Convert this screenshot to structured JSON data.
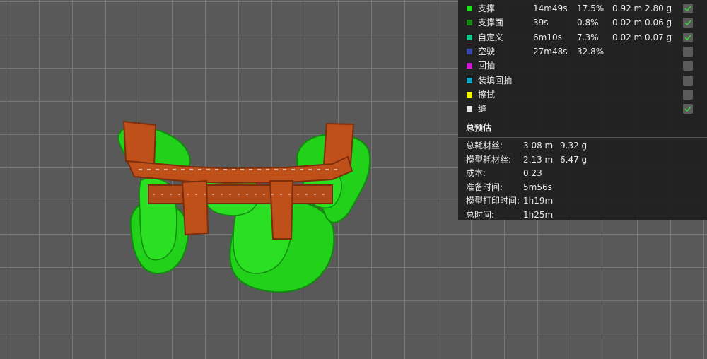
{
  "legend": {
    "rows": [
      {
        "name": "支撑",
        "time": "14m49s",
        "percent": "17.5%",
        "length": "0.92 m",
        "weight": "2.80 g",
        "color": "#21e01d",
        "checked": true
      },
      {
        "name": "支撑面",
        "time": "39s",
        "percent": "0.8%",
        "length": "0.02 m",
        "weight": "0.06 g",
        "color": "#1a8a16",
        "checked": true
      },
      {
        "name": "自定义",
        "time": "6m10s",
        "percent": "7.3%",
        "length": "0.02 m",
        "weight": "0.07 g",
        "color": "#19c38a",
        "checked": true
      },
      {
        "name": "空驶",
        "time": "27m48s",
        "percent": "32.8%",
        "length": "",
        "weight": "",
        "color": "#3a44a8",
        "checked": false
      },
      {
        "name": "回抽",
        "time": "",
        "percent": "",
        "length": "",
        "weight": "",
        "color": "#d418d4",
        "checked": false
      },
      {
        "name": "装填回抽",
        "time": "",
        "percent": "",
        "length": "",
        "weight": "",
        "color": "#16a7c7",
        "checked": false
      },
      {
        "name": "擦拭",
        "time": "",
        "percent": "",
        "length": "",
        "weight": "",
        "color": "#f2f20a",
        "checked": false
      },
      {
        "name": "缝",
        "time": "",
        "percent": "",
        "length": "",
        "weight": "",
        "color": "#e6e6e6",
        "checked": true
      }
    ]
  },
  "summary": {
    "title": "总预估",
    "rows": [
      {
        "label": "总耗材丝:",
        "value1": "3.08 m",
        "value2": "9.32 g"
      },
      {
        "label": "模型耗材丝:",
        "value1": "2.13 m",
        "value2": "6.47 g"
      },
      {
        "label": "成本:",
        "value1": "0.23",
        "value2": ""
      },
      {
        "label": "准备时间:",
        "value1": "5m56s",
        "value2": ""
      },
      {
        "label": "模型打印时间:",
        "value1": "1h19m",
        "value2": ""
      },
      {
        "label": "总时间:",
        "value1": "1h25m",
        "value2": ""
      }
    ]
  },
  "colors": {
    "support": "#22d11a",
    "support_dark": "#0f8a0c",
    "model": "#c0501a",
    "model_dark": "#7a2e0c",
    "check": "#3fcf3f"
  }
}
